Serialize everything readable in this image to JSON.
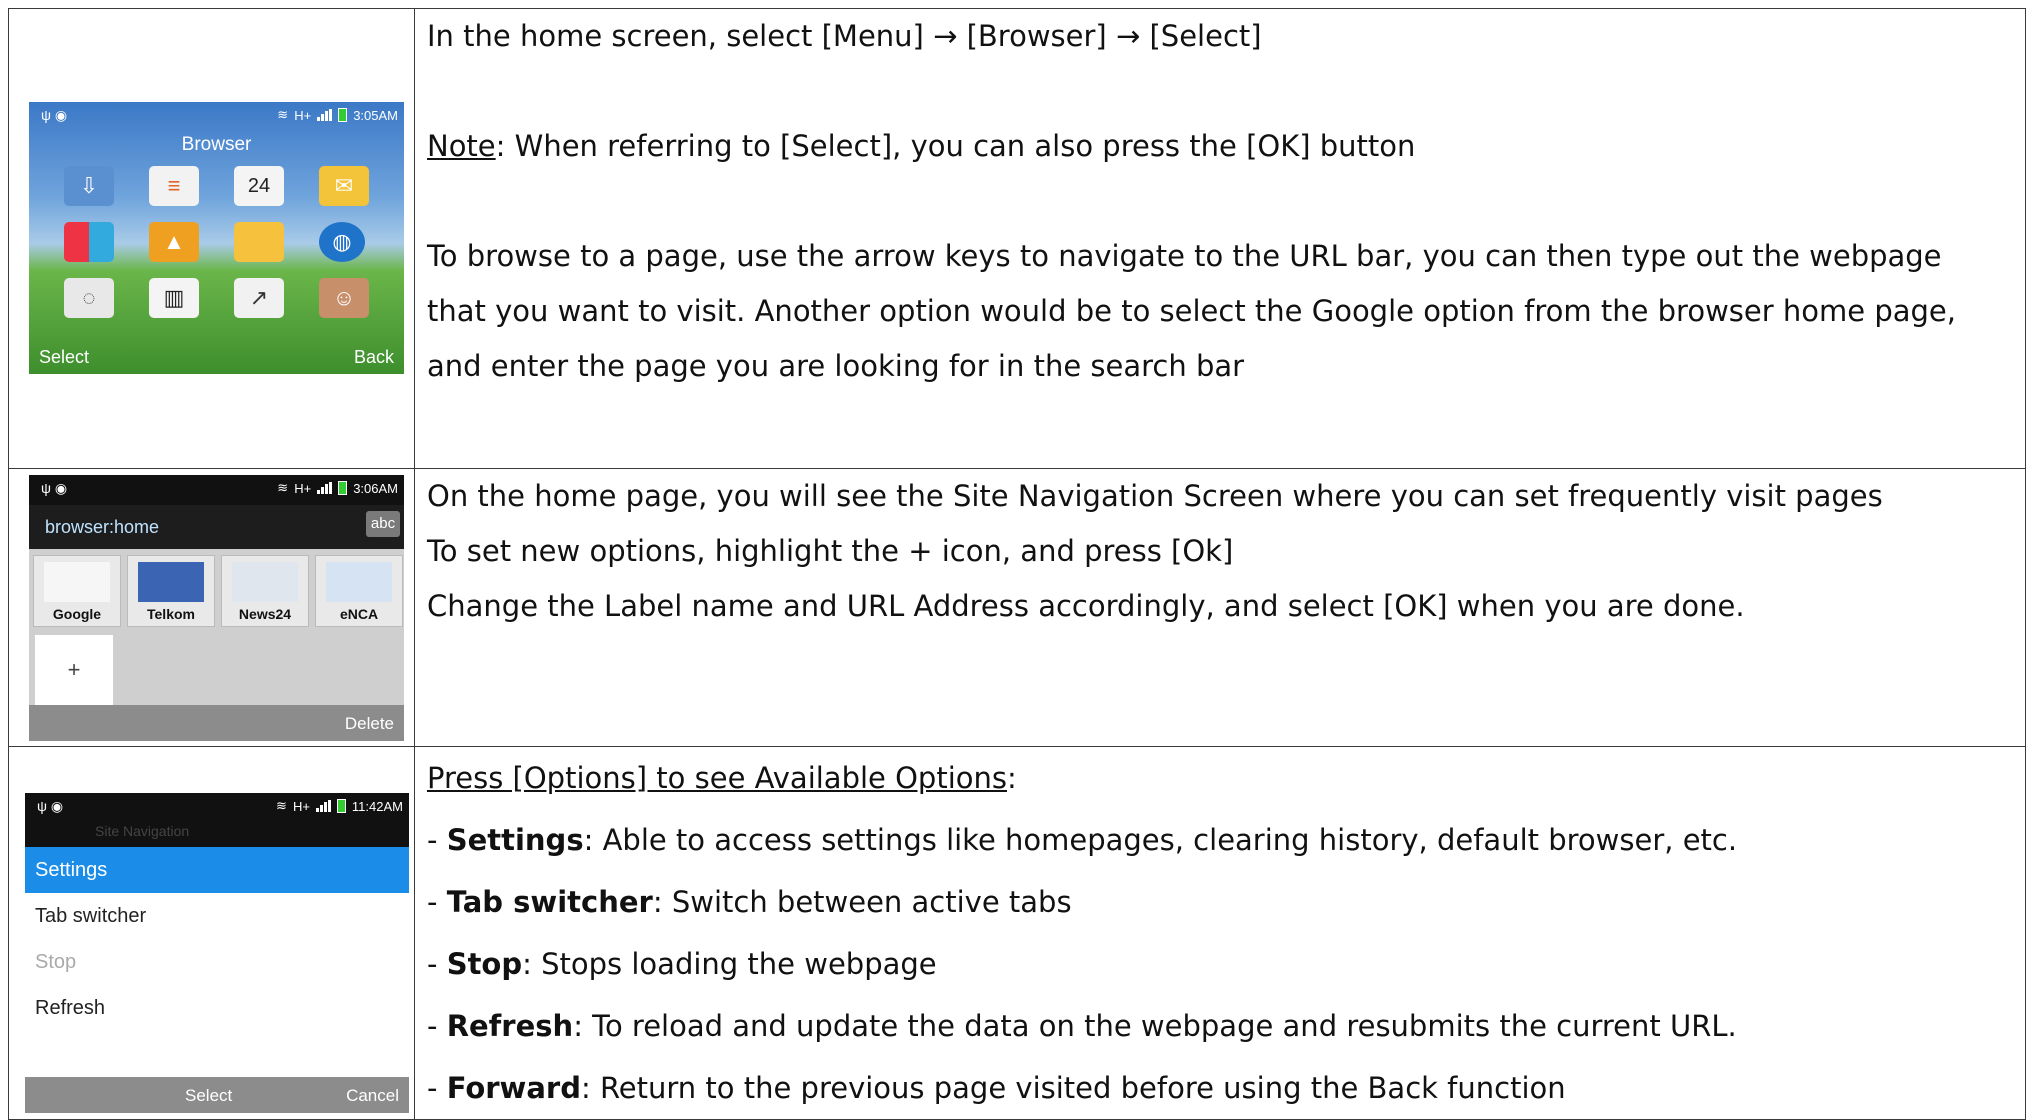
{
  "rows": [
    {
      "lines": [
        "In the home screen, select [Menu] → [Browser] → [Select]",
        "",
        "Note: When referring to [Select], you can also press the [OK] button",
        "",
        "To browse to a page, use the arrow keys to navigate to the URL bar, you can then type out the webpage",
        "that you want to visit. Another option would be to select the Google option from the browser home page,",
        "and enter the page you are looking for in the search bar"
      ],
      "note_label": "Note",
      "note_rest": ": When referring to [Select], you can also press the [OK] button"
    },
    {
      "lines": [
        "On the home page, you will see the Site Navigation Screen where you can set frequently visit pages",
        "To set new options, highlight the + icon, and press [Ok]",
        "Change the Label name and URL Address accordingly, and select [OK] when you are done."
      ]
    },
    {
      "heading": "Press [Options] to see Available Options",
      "heading_colon": ":",
      "items": [
        {
          "term": "Settings",
          "desc": ": Able to access settings like homepages, clearing history, default browser, etc."
        },
        {
          "term": "Tab switcher",
          "desc": ": Switch between active tabs"
        },
        {
          "term": "Stop",
          "desc": ": Stops loading the webpage"
        },
        {
          "term": "Refresh",
          "desc": ": To reload and update the data on the webpage and resubmits the current URL."
        },
        {
          "term": "Forward",
          "desc": ": Return to the previous page visited before using the Back function"
        }
      ]
    }
  ],
  "phone1": {
    "time": "3:05AM",
    "network": "H+",
    "title": "Browser",
    "calendar_day": "24",
    "softkey_left": "Select",
    "softkey_right": "Back"
  },
  "phone2": {
    "time": "3:06AM",
    "network": "H+",
    "url": "browser:home",
    "ime": "abc",
    "tiles": [
      "Google",
      "Telkom",
      "News24",
      "eNCA"
    ],
    "add": "+",
    "softkey_right": "Delete"
  },
  "phone3": {
    "time": "11:42AM",
    "network": "H+",
    "ghost_title": "Site Navigation",
    "menu": [
      "Settings",
      "Tab switcher",
      "Stop",
      "Refresh"
    ],
    "softkey_mid": "Select",
    "softkey_right": "Cancel"
  }
}
